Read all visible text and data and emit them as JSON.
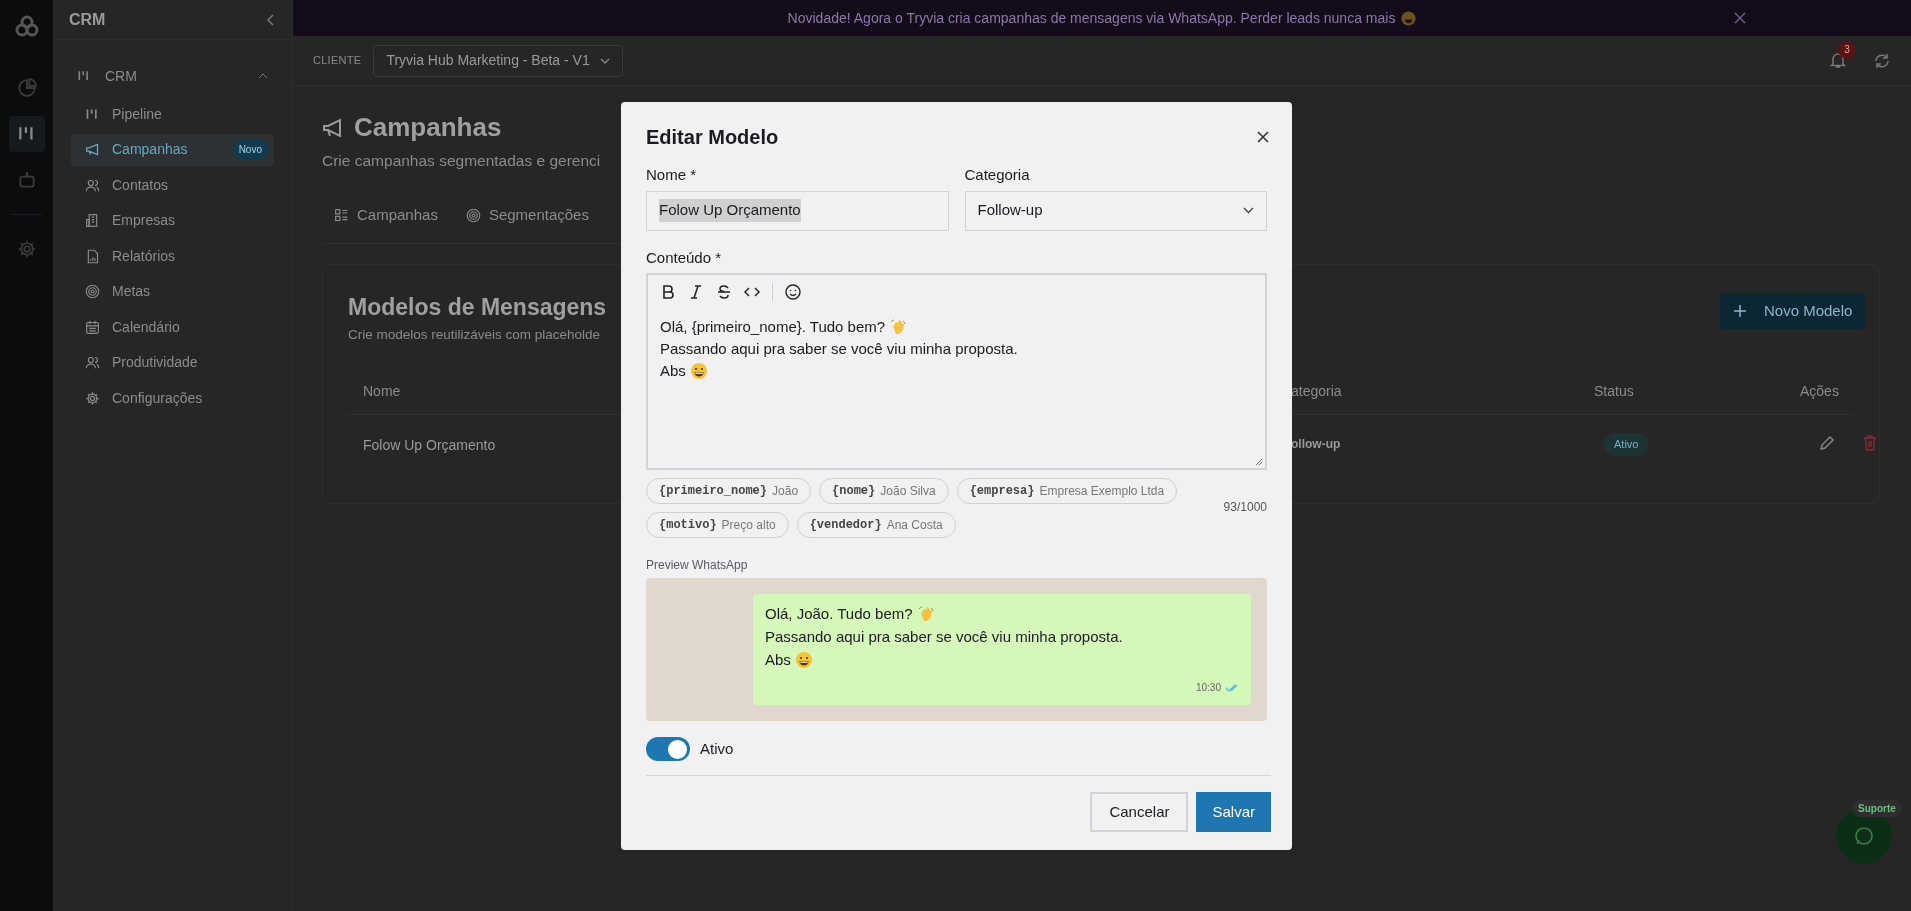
{
  "banner": {
    "text": "Novidade! Agora o Tryvia cria campanhas de mensagens via WhatsApp. Perder leads nunca mais"
  },
  "header": {
    "client_label": "CLIENTE",
    "client_value": "Tryvia Hub Marketing - Beta - V1",
    "notifications": "3"
  },
  "rail": [
    {
      "selected": false
    },
    {
      "selected": true
    },
    {
      "selected": false
    },
    {
      "selected": false
    }
  ],
  "sidebar": {
    "title": "CRM",
    "group": {
      "label": "CRM",
      "expanded": true
    },
    "items": [
      {
        "label": "Pipeline",
        "selected": false
      },
      {
        "label": "Campanhas",
        "selected": true,
        "badge": "Novo"
      },
      {
        "label": "Contatos",
        "selected": false
      },
      {
        "label": "Empresas",
        "selected": false
      },
      {
        "label": "Relatórios",
        "selected": false
      },
      {
        "label": "Metas",
        "selected": false
      },
      {
        "label": "Calendário",
        "selected": false
      },
      {
        "label": "Produtividade",
        "selected": false
      },
      {
        "label": "Configurações",
        "selected": false
      }
    ]
  },
  "page": {
    "title": "Campanhas",
    "subtitle": "Crie campanhas segmentadas e gerenci",
    "tabs": [
      {
        "label": "Campanhas"
      },
      {
        "label": "Segmentações"
      }
    ],
    "card": {
      "title": "Modelos de Mensagens",
      "subtitle": "Crie modelos reutilizáveis com placeholde",
      "new_button": "Novo Modelo",
      "columns": [
        "Nome",
        "ategoria",
        "Status",
        "Ações"
      ],
      "rows": [
        {
          "name": "Folow Up Orçamento",
          "category": "ollow-up",
          "status": "Ativo"
        }
      ]
    }
  },
  "support": {
    "label": "Suporte"
  },
  "modal": {
    "title": "Editar Modelo",
    "name": {
      "label": "Nome *",
      "value": "Folow Up Orçamento",
      "text_selected": true
    },
    "category": {
      "label": "Categoria",
      "value": "Follow-up"
    },
    "content": {
      "label": "Conteúdo *",
      "lines": [
        "Olá, {primeiro_nome}. Tudo bem?",
        "Passando aqui pra saber se você viu minha proposta.",
        "Abs"
      ]
    },
    "placeholders": [
      {
        "token": "{primeiro_nome}",
        "example": "João"
      },
      {
        "token": "{nome}",
        "example": "João Silva"
      },
      {
        "token": "{empresa}",
        "example": "Empresa Exemplo Ltda"
      },
      {
        "token": "{motivo}",
        "example": "Preço alto"
      },
      {
        "token": "{vendedor}",
        "example": "Ana Costa"
      }
    ],
    "counter": "93/1000",
    "preview": {
      "label": "Preview WhatsApp",
      "lines": [
        "Olá, João. Tudo bem?",
        "Passando aqui pra saber se você viu minha proposta.",
        "Abs"
      ],
      "time": "10:30",
      "read": true
    },
    "active": {
      "label": "Ativo",
      "on": true
    },
    "buttons": {
      "cancel": "Cancelar",
      "save": "Salvar"
    }
  }
}
